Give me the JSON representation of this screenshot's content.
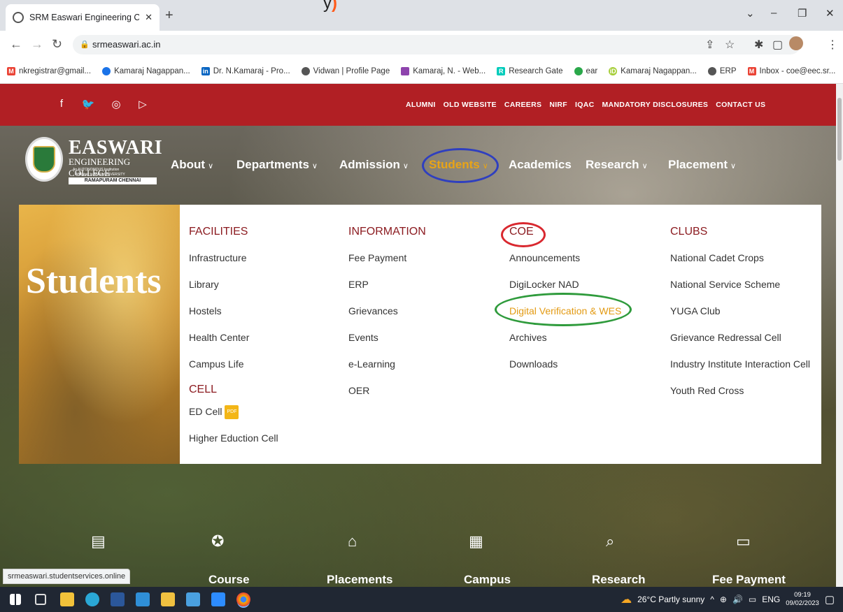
{
  "banner": {
    "text": "y"
  },
  "browser": {
    "tab_title": "SRM Easwari Engineering College",
    "tab_close": "✕",
    "new_tab": "+",
    "url": "srmeaswari.ac.in",
    "bookmarks": [
      "nkregistrar@gmail...",
      "Kamaraj Nagappan...",
      "Dr. N.Kamaraj - Pro...",
      "Vidwan | Profile Page",
      "Kamaraj, N. - Web...",
      "Research Gate",
      "ear",
      "Kamaraj Nagappan...",
      "ERP",
      "Inbox - coe@eec.sr..."
    ]
  },
  "site": {
    "utility_links": [
      "ALUMNI",
      "OLD WEBSITE",
      "CAREERS",
      "NIRF",
      "IQAC",
      "MANDATORY DISCLOSURES",
      "CONTACT US"
    ],
    "logo": {
      "name": "EASWARI",
      "sub": "ENGINEERING COLLEGE",
      "line1": "An AUTONOMOUS Institution",
      "line2": "Affiliated to ANNA UNIVERSITY",
      "city": "RAMAPURAM CHENNAI"
    },
    "nav": [
      "About",
      "Departments",
      "Admission",
      "Students",
      "Academics",
      "Research",
      "Placement"
    ],
    "mega": {
      "image_title": "Students",
      "facilities": {
        "title": "FACILITIES",
        "items": [
          "Infrastructure",
          "Library",
          "Hostels",
          "Health Center",
          "Campus Life"
        ]
      },
      "cell": {
        "title": "CELL",
        "items": [
          "ED Cell",
          "Higher Eduction Cell"
        ],
        "pdf_badge": "PDF"
      },
      "information": {
        "title": "INFORMATION",
        "items": [
          "Fee Payment",
          "ERP",
          "Grievances",
          "Events",
          "e-Learning",
          "OER"
        ]
      },
      "coe": {
        "title": "COE",
        "items": [
          "Announcements",
          "DigiLocker NAD",
          "Digital Verification & WES",
          "Archives",
          "Downloads"
        ]
      },
      "clubs": {
        "title": "CLUBS",
        "items": [
          "National Cadet Crops",
          "National Service Scheme",
          "YUGA Club",
          "Grievance Redressal Cell",
          "Industry Institute Interaction Cell",
          "Youth Red Cross"
        ]
      }
    },
    "quick_links": [
      "Course",
      "Placements",
      "Campus",
      "Research",
      "Fee Payment"
    ],
    "status_url": "srmeaswari.studentservices.online"
  },
  "taskbar": {
    "weather": "26°C  Partly sunny",
    "lang": "ENG",
    "time": "09:19",
    "date": "09/02/2023"
  },
  "colors": {
    "brand_red": "#b11f24",
    "heading_red": "#8b1a1f",
    "highlight_orange": "#e39a12",
    "annotation_blue": "#2f3fbf",
    "annotation_red": "#d9282f",
    "annotation_green": "#2f9b3c"
  }
}
